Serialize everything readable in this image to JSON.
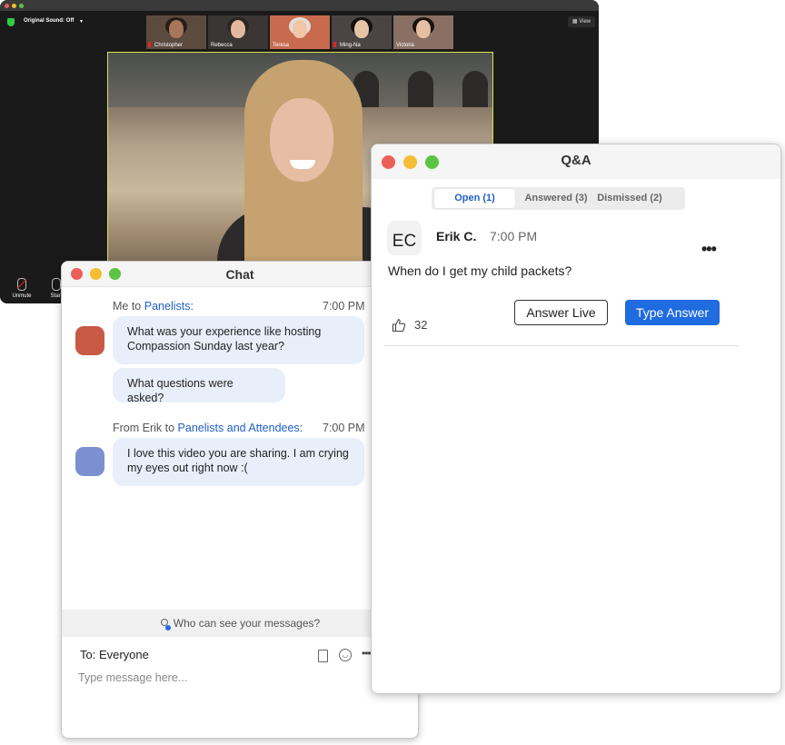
{
  "colors": {
    "close": "#ec5f57",
    "minimize": "#f5bd32",
    "maximize": "#5dc443",
    "accent_blue": "#1f6be0",
    "link_blue": "#1f5fc7",
    "avatar_me": "#c85a45",
    "avatar_erik": "#7b8fd1"
  },
  "meeting": {
    "original_sound": "Original Sound: Off",
    "view_label": "View",
    "participants": [
      {
        "name": "Christopher",
        "muted": true
      },
      {
        "name": "Rebecca",
        "muted": false
      },
      {
        "name": "Teresa",
        "muted": false
      },
      {
        "name": "Ming-Na",
        "muted": true
      },
      {
        "name": "Victoria",
        "muted": false
      }
    ],
    "toolbar": {
      "unmute": "Unmute",
      "start": "Start"
    }
  },
  "chat": {
    "title": "Chat",
    "messages": [
      {
        "prefix": "Me to ",
        "recipient": "Panelists:",
        "time": "7:00 PM",
        "bubbles": [
          "What was your experience like hosting Compassion Sunday last year?",
          "What questions were asked?"
        ]
      },
      {
        "prefix": "From Erik to ",
        "recipient": "Panelists and Attendees:",
        "time": "7:00 PM",
        "bubbles": [
          "I love this video you are sharing. I am crying my eyes out right now :("
        ]
      }
    ],
    "who_can_see": "Who can see your messages?",
    "to_label": "To: Everyone",
    "input_placeholder": "Type message here..."
  },
  "qa": {
    "title": "Q&A",
    "tabs": [
      {
        "label": "Open (1)",
        "active": true
      },
      {
        "label": "Answered (3)",
        "active": false
      },
      {
        "label": "Dismissed (2)",
        "active": false
      }
    ],
    "question": {
      "initials": "EC",
      "author": "Erik C.",
      "time": "7:00 PM",
      "text": "When do I get my child packets?",
      "likes": "32",
      "answer_live": "Answer Live",
      "type_answer": "Type Answer"
    }
  }
}
